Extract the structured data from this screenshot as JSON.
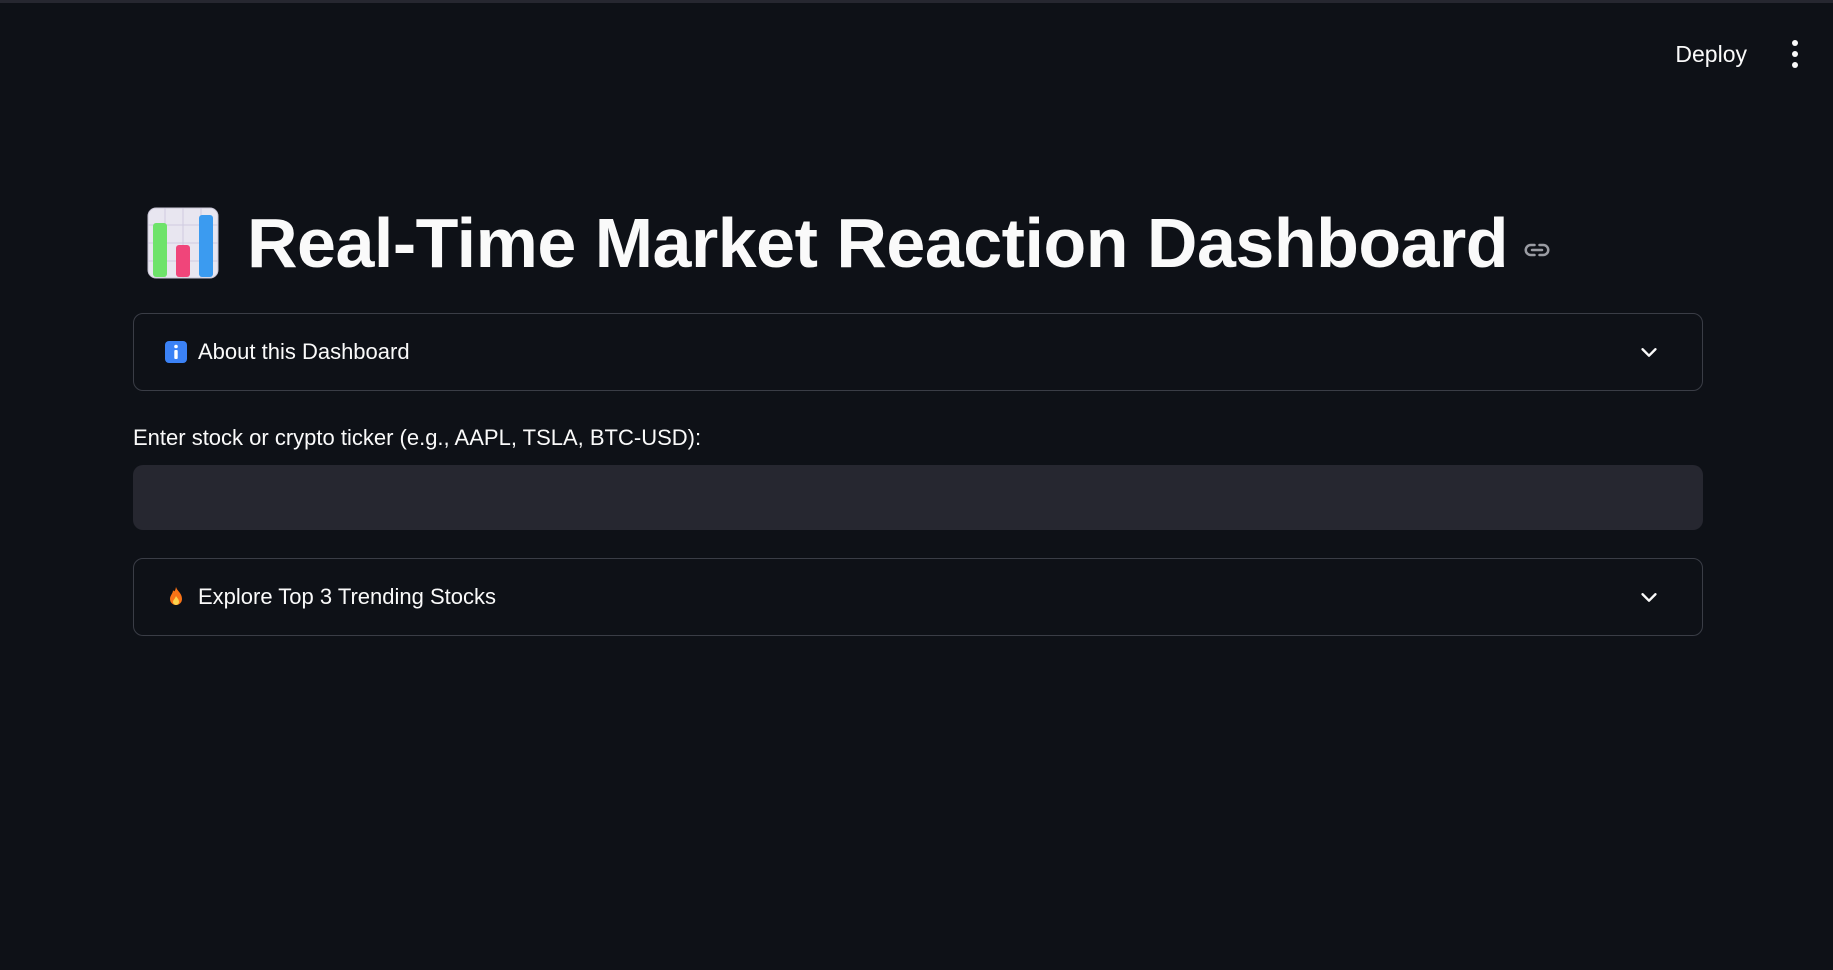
{
  "header": {
    "deploy_label": "Deploy",
    "menu_icon": "vertical-ellipsis-icon"
  },
  "page": {
    "title_icon": "bar-chart-icon",
    "title": "Real-Time Market Reaction Dashboard",
    "link_icon": "link-icon"
  },
  "about_expander": {
    "icon": "info-icon",
    "label": "About this Dashboard",
    "expanded": false
  },
  "ticker_input": {
    "label": "Enter stock or crypto ticker (e.g., AAPL, TSLA, BTC-USD):",
    "value": "",
    "placeholder": ""
  },
  "trending_expander": {
    "icon": "fire-icon",
    "label": "Explore Top 3 Trending Stocks",
    "expanded": false
  },
  "colors": {
    "background": "#0e1117",
    "input_background": "#262730",
    "border": "#3a3d46",
    "text": "#fafafa",
    "info_blue": "#3b82f6",
    "fire_orange": "#f97316"
  }
}
